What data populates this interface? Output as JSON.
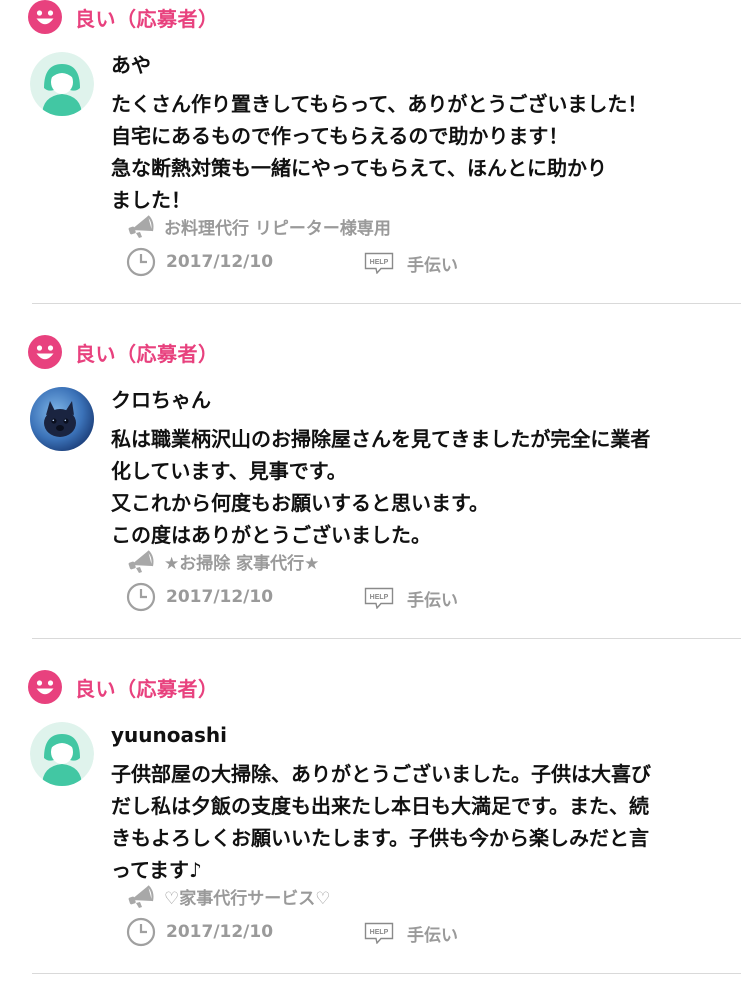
{
  "colors": {
    "pink": "#e8417e",
    "mint": "#42c7a3",
    "meta_gray": "#9a9a9a",
    "divider": "#d9d9d9"
  },
  "reviews": [
    {
      "rating_label": "良い（応募者）",
      "rating_icon": "smile-icon",
      "avatar": "default-avatar-icon",
      "username": "あや",
      "comment_lines": [
        "たくさん作り置きしてもらって、ありがとうございました！",
        "自宅にあるもので作ってもらえるので助かります！",
        "急な断熱対策も一緒にやってもらえて、ほんとに助かり",
        "ました！"
      ],
      "service_name": "お料理代行 リピーター様専用",
      "date": "2017/12/10",
      "category": "手伝い"
    },
    {
      "rating_label": "良い（応募者）",
      "rating_icon": "smile-icon",
      "avatar": "dog-photo-avatar",
      "username": "クロちゃん",
      "comment_lines": [
        "私は職業柄沢山のお掃除屋さんを見てきましたが完全に業者",
        "化しています、見事です。",
        "又これから何度もお願いすると思います。",
        "この度はありがとうございました。"
      ],
      "service_name": "★お掃除 家事代行★",
      "date": "2017/12/10",
      "category": "手伝い"
    },
    {
      "rating_label": "良い（応募者）",
      "rating_icon": "smile-icon",
      "avatar": "default-avatar-icon",
      "username": "yuunoashi",
      "comment_lines": [
        "子供部屋の大掃除、ありがとうございました。子供は大喜び",
        "だし私は夕飯の支度も出来たし本日も大満足です。また、続",
        "きもよろしくお願いいたします。子供も今から楽しみだと言",
        "ってます♪"
      ],
      "service_name": "♡家事代行サービス♡",
      "date": "2017/12/10",
      "category": "手伝い"
    }
  ],
  "icons": {
    "service": "megaphone-icon",
    "date": "clock-icon",
    "category": "help-tag-icon",
    "help_tag_text": "HELP"
  }
}
